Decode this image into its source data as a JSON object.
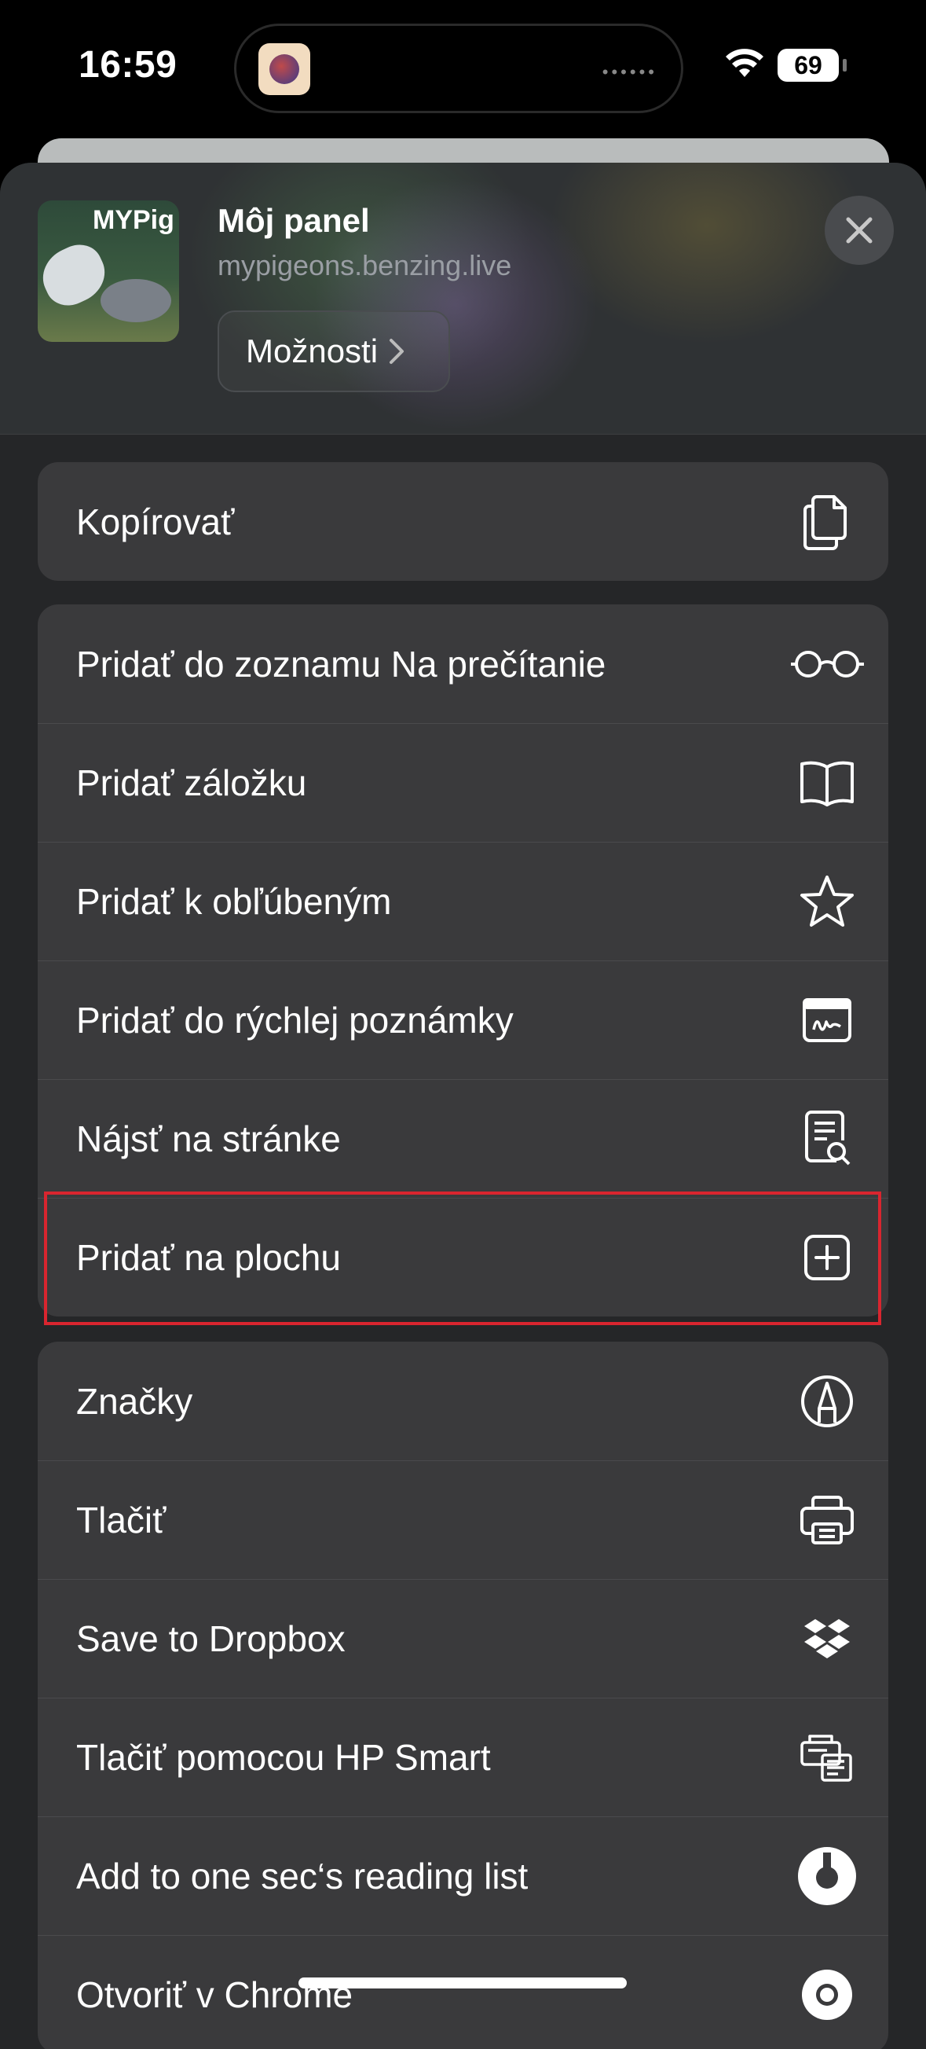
{
  "status_bar": {
    "time": "16:59",
    "battery": "69"
  },
  "header": {
    "thumb_logo": "MYPig",
    "title": "Môj panel",
    "url": "mypigeons.benzing.live",
    "options_label": "Možnosti"
  },
  "groups": [
    {
      "items": [
        {
          "label": "Kopírovať",
          "icon": "copy-icon"
        }
      ]
    },
    {
      "items": [
        {
          "label": "Pridať do zoznamu Na prečítanie",
          "icon": "glasses-icon"
        },
        {
          "label": "Pridať záložku",
          "icon": "book-icon"
        },
        {
          "label": "Pridať k obľúbeným",
          "icon": "star-icon"
        },
        {
          "label": "Pridať do rýchlej poznámky",
          "icon": "quick-note-icon"
        },
        {
          "label": "Nájsť na stránke",
          "icon": "find-on-page-icon"
        },
        {
          "label": "Pridať na plochu",
          "icon": "add-square-icon",
          "highlighted": true
        }
      ]
    },
    {
      "items": [
        {
          "label": "Značky",
          "icon": "markup-icon"
        },
        {
          "label": "Tlačiť",
          "icon": "print-icon"
        },
        {
          "label": "Save to Dropbox",
          "icon": "dropbox-icon"
        },
        {
          "label": "Tlačiť pomocou HP Smart",
          "icon": "hp-smart-icon"
        },
        {
          "label": "Add to one sec‘s reading list",
          "icon": "one-sec-icon"
        },
        {
          "label": "Otvoriť v Chrome",
          "icon": "chrome-icon"
        }
      ]
    }
  ],
  "colors": {
    "highlight": "#d9252f",
    "row_bg": "#3a3a3c",
    "sheet_bg": "#252628"
  }
}
